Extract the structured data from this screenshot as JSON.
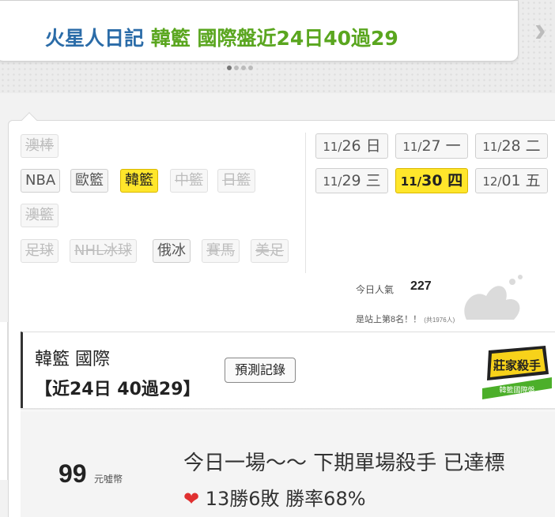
{
  "banner": {
    "title_blue": "火星人日記",
    "title_green": "韓籃 國際盤近24日40過29",
    "next_icon": "chevron-right-icon"
  },
  "sports": {
    "row1": [
      {
        "label": "澳棒",
        "state": "disabled"
      }
    ],
    "row2": [
      {
        "label": "NBA",
        "state": "normal"
      },
      {
        "label": "歐籃",
        "state": "normal"
      },
      {
        "label": "韓籃",
        "state": "active"
      },
      {
        "label": "中籃",
        "state": "disabled"
      },
      {
        "label": "日籃",
        "state": "disabled"
      }
    ],
    "row3": [
      {
        "label": "澳籃",
        "state": "disabled"
      }
    ],
    "row4": [
      {
        "label": "足球",
        "state": "disabled"
      },
      {
        "label": "NHL冰球",
        "state": "disabled"
      },
      {
        "label": "俄冰",
        "state": "normal"
      },
      {
        "label": "賽馬",
        "state": "disabled"
      },
      {
        "label": "美足",
        "state": "disabled"
      }
    ]
  },
  "dates": [
    {
      "md": "11/",
      "day": "26 日",
      "state": "normal"
    },
    {
      "md": "11/",
      "day": "27 一",
      "state": "normal"
    },
    {
      "md": "11/",
      "day": "28 二",
      "state": "normal"
    },
    {
      "md": "11/",
      "day": "29 三",
      "state": "normal"
    },
    {
      "md": "11/",
      "day": "30 四",
      "state": "active"
    },
    {
      "md": "12/",
      "day": "01 五",
      "state": "normal"
    }
  ],
  "popularity": {
    "label": "今日人氣",
    "value": "227",
    "rank_text": "是站上第8名！！",
    "rank_total": "(共1976人)"
  },
  "info": {
    "title": "韓籃 國際",
    "record": "【近24日 40過29】",
    "predict_button": "預測記錄",
    "badge_text": "莊家殺手",
    "badge_sub": "韓籃國際盤"
  },
  "offer": {
    "price": "99",
    "unit": "元噓幣",
    "desc1": "今日一場～～ 下期單場殺手 已達標",
    "desc2": "13勝6敗 勝率68%",
    "heart_icon": "heart-icon"
  },
  "colors": {
    "accent_yellow": "#ffe62b",
    "title_blue": "#2b6ca8",
    "title_green": "#5aa61f"
  }
}
